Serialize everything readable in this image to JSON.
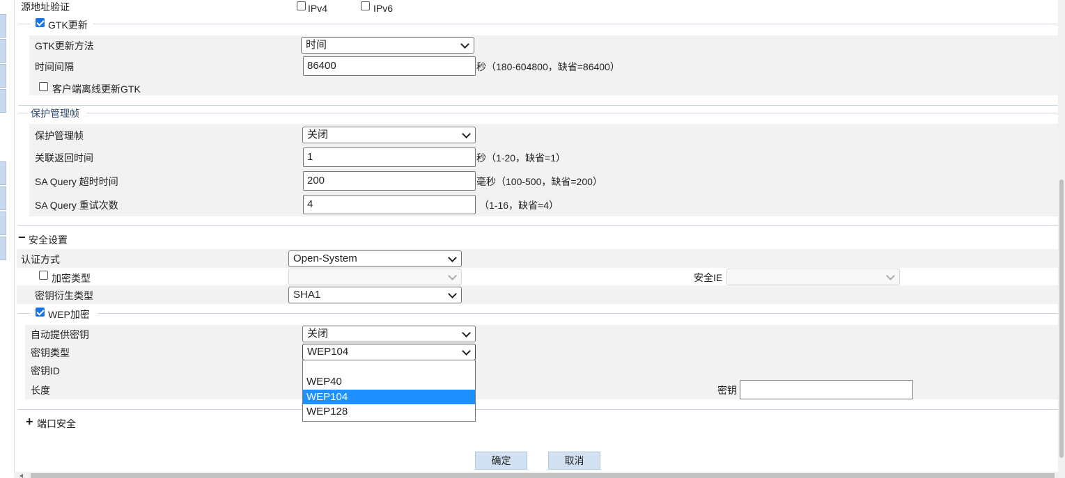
{
  "top": {
    "src_addr_label": "源地址验证",
    "ipv4_label": "IPv4",
    "ipv6_label": "IPv6"
  },
  "gtk": {
    "section_label": "GTK更新",
    "method_label": "GTK更新方法",
    "method_value": "时间",
    "interval_label": "时间间隔",
    "interval_value": "86400",
    "interval_hint": "秒（180-604800，缺省=86400）",
    "offline_label": "客户端离线更新GTK"
  },
  "pmf": {
    "section_label": "保护管理帧",
    "pmf_label": "保护管理帧",
    "pmf_value": "关闭",
    "assoc_label": "关联返回时间",
    "assoc_value": "1",
    "assoc_hint": "秒（1-20，缺省=1）",
    "sa_timeout_label": "SA Query 超时时间",
    "sa_timeout_value": "200",
    "sa_timeout_hint": "毫秒（100-500，缺省=200）",
    "sa_retry_label": "SA Query 重试次数",
    "sa_retry_value": "4",
    "sa_retry_hint": "（1-16，缺省=4）"
  },
  "security": {
    "section_label": "安全设置",
    "auth_label": "认证方式",
    "auth_value": "Open-System",
    "encrypt_label": "加密类型",
    "encrypt_value": "",
    "security_ie_label": "安全IE",
    "security_ie_value": "",
    "key_derive_label": "密钥衍生类型",
    "key_derive_value": "SHA1"
  },
  "wep": {
    "section_label": "WEP加密",
    "auto_key_label": "自动提供密钥",
    "auto_key_value": "关闭",
    "key_type_label": "密钥类型",
    "key_type_value": "WEP104",
    "key_id_label": "密钥ID",
    "length_label": "长度",
    "key_label": "密钥",
    "key_value": "",
    "dropdown_options": [
      "",
      "WEP40",
      "WEP104",
      "WEP128"
    ],
    "dropdown_selected": "WEP104"
  },
  "port_security": {
    "section_label": "端口安全"
  },
  "buttons": {
    "ok": "确定",
    "cancel": "取消"
  },
  "colors": {
    "panel_bg": "#f2f2f2",
    "accent": "#1a73e8",
    "highlight": "#1e90ff",
    "button_bg": "#d2e1f2"
  }
}
